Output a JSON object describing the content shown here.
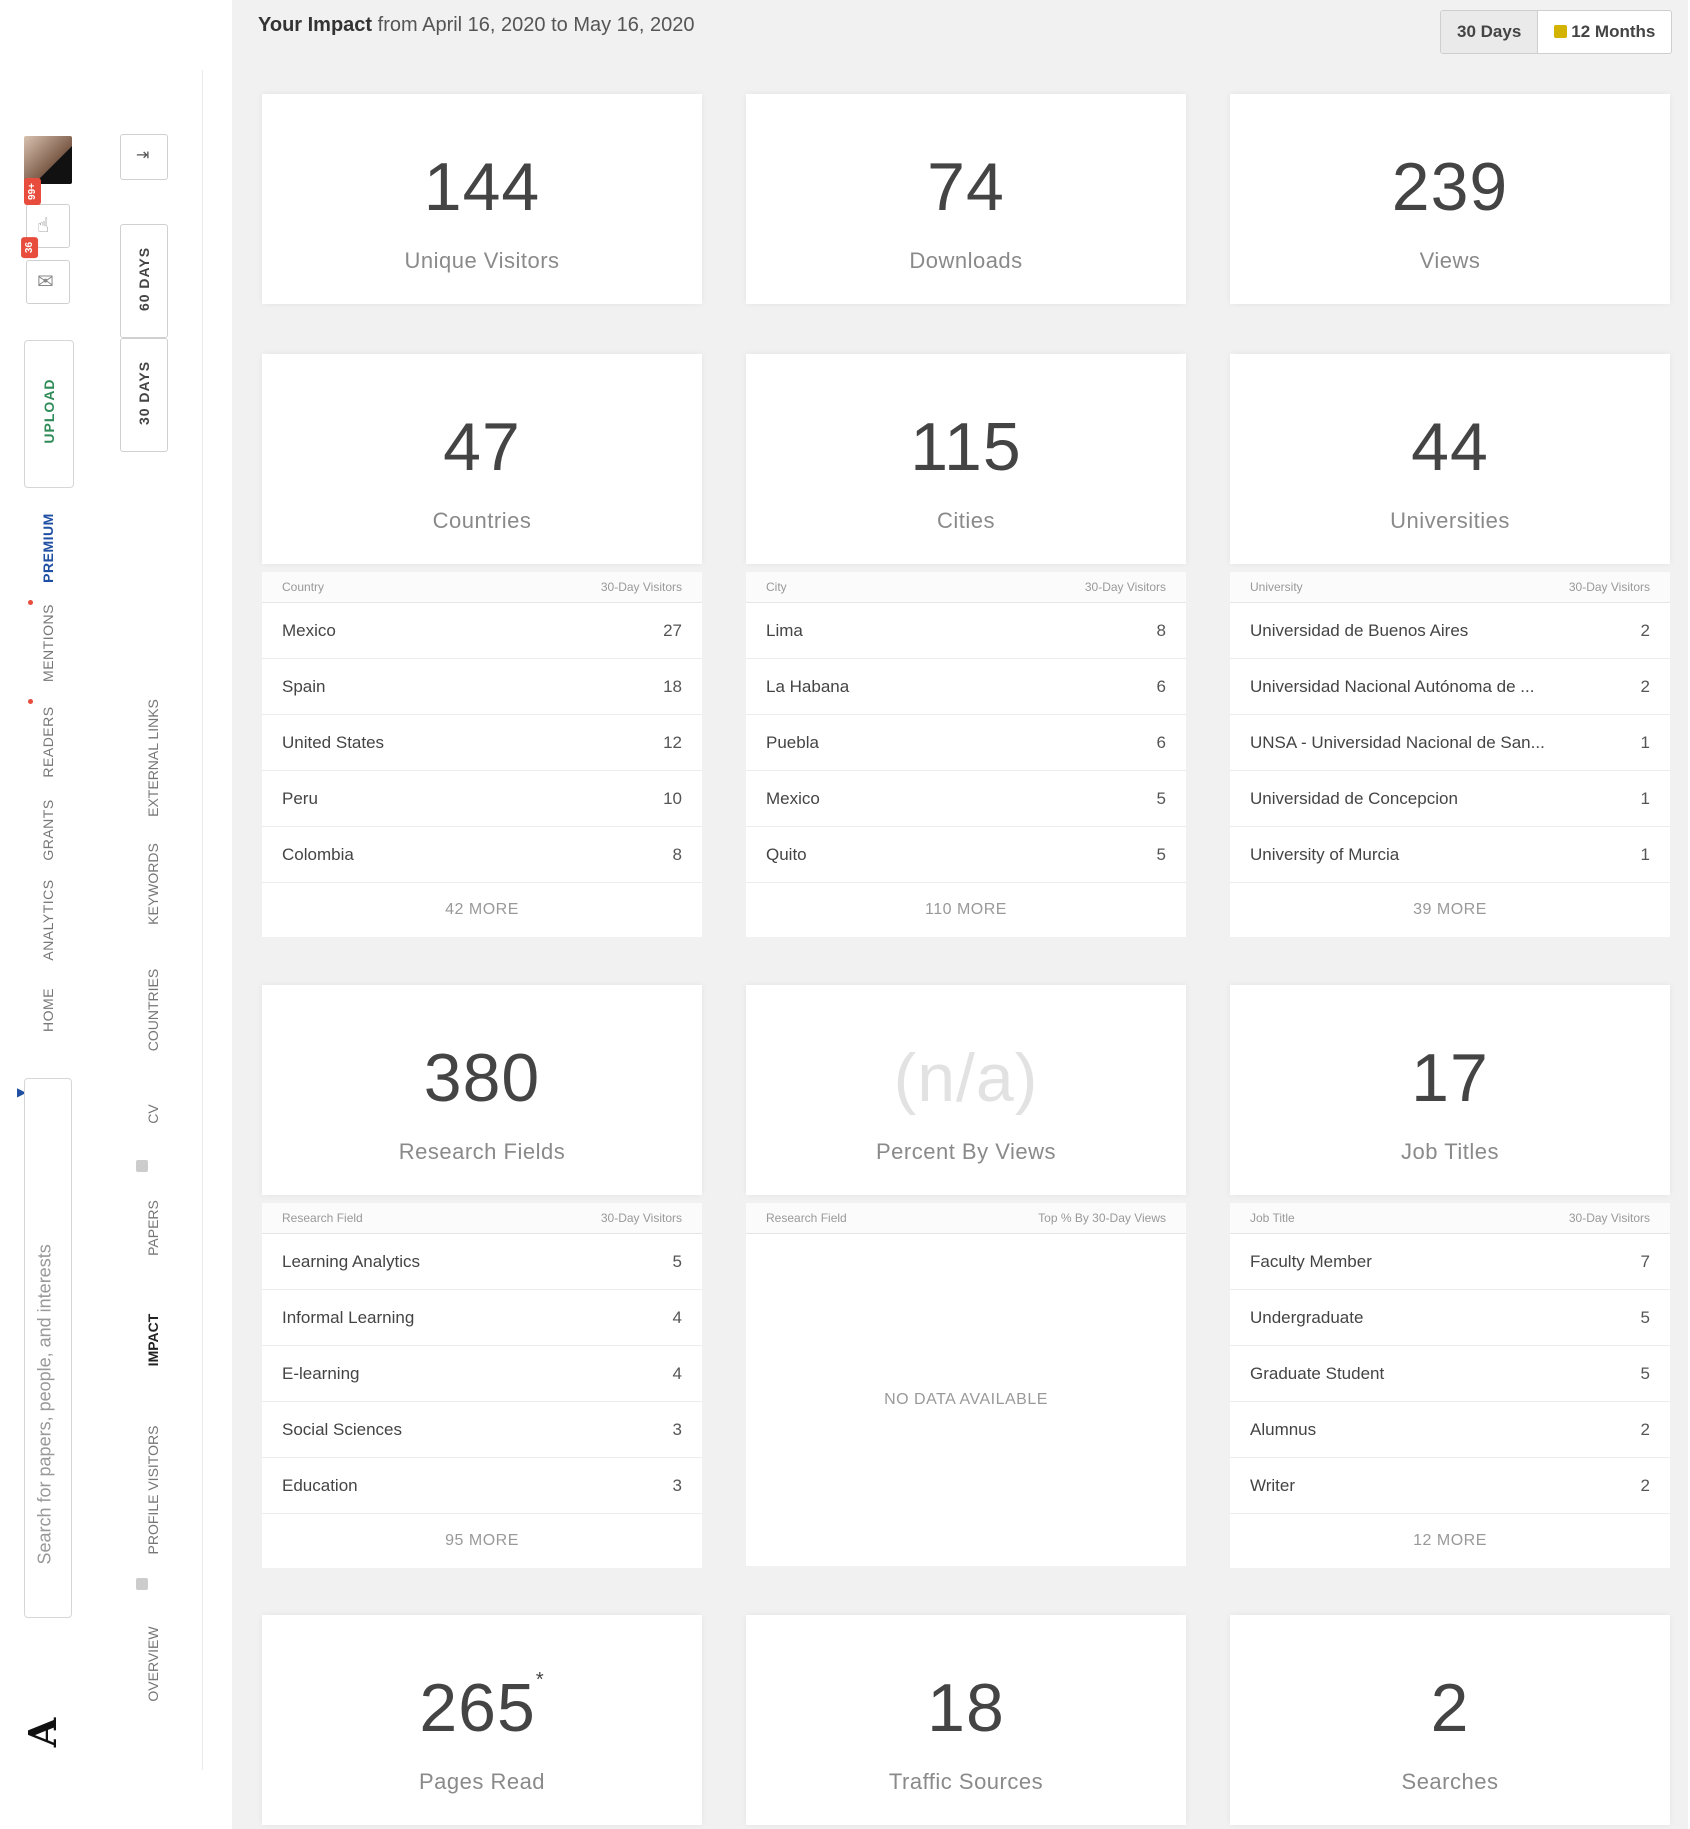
{
  "header": {
    "title_bold": "Your Impact",
    "title_rest": " from April 16, 2020 to May 16, 2020",
    "range_buttons": [
      "30 Days",
      "12 Months"
    ]
  },
  "rail": {
    "notif_badges": [
      "99+",
      "36"
    ],
    "upload_label": "UPLOAD",
    "links": [
      "PREMIUM",
      "MENTIONS",
      "READERS",
      "GRANTS",
      "ANALYTICS",
      "HOME"
    ],
    "search_placeholder": "Search for papers, people, and interests",
    "logo": "A"
  },
  "nav2": {
    "period_buttons": [
      "60 DAYS",
      "30 DAYS"
    ],
    "links": [
      "EXTERNAL LINKS",
      "KEYWORDS",
      "COUNTRIES",
      "CV",
      "PAPERS",
      "IMPACT",
      "PROFILE VISITORS",
      "OVERVIEW"
    ]
  },
  "stats_top": [
    {
      "value": "144",
      "label": "Unique Visitors"
    },
    {
      "value": "74",
      "label": "Downloads"
    },
    {
      "value": "239",
      "label": "Views"
    }
  ],
  "breakdowns_1": [
    {
      "value": "47",
      "label": "Countries",
      "col_left": "Country",
      "col_right": "30-Day Visitors",
      "rows": [
        [
          "Mexico",
          "27"
        ],
        [
          "Spain",
          "18"
        ],
        [
          "United States",
          "12"
        ],
        [
          "Peru",
          "10"
        ],
        [
          "Colombia",
          "8"
        ]
      ],
      "more": "42 MORE"
    },
    {
      "value": "115",
      "label": "Cities",
      "col_left": "City",
      "col_right": "30-Day Visitors",
      "rows": [
        [
          "Lima",
          "8"
        ],
        [
          "La Habana",
          "6"
        ],
        [
          "Puebla",
          "6"
        ],
        [
          "Mexico",
          "5"
        ],
        [
          "Quito",
          "5"
        ]
      ],
      "more": "110 MORE"
    },
    {
      "value": "44",
      "label": "Universities",
      "col_left": "University",
      "col_right": "30-Day Visitors",
      "rows": [
        [
          "Universidad de Buenos Aires",
          "2"
        ],
        [
          "Universidad Nacional Autónoma de ...",
          "2"
        ],
        [
          "UNSA - Universidad Nacional de San...",
          "1"
        ],
        [
          "Universidad de Concepcion",
          "1"
        ],
        [
          "University of Murcia",
          "1"
        ]
      ],
      "more": "39 MORE"
    }
  ],
  "breakdowns_2": [
    {
      "value": "380",
      "label": "Research Fields",
      "col_left": "Research Field",
      "col_right": "30-Day Visitors",
      "rows": [
        [
          "Learning Analytics",
          "5"
        ],
        [
          "Informal Learning",
          "4"
        ],
        [
          "E-learning",
          "4"
        ],
        [
          "Social Sciences",
          "3"
        ],
        [
          "Education",
          "3"
        ]
      ],
      "more": "95 MORE"
    },
    {
      "value": "(n/a)",
      "label": "Percent By Views",
      "col_left": "Research Field",
      "col_right": "Top % By 30-Day Views",
      "nodata": "NO DATA AVAILABLE"
    },
    {
      "value": "17",
      "label": "Job Titles",
      "col_left": "Job Title",
      "col_right": "30-Day Visitors",
      "rows": [
        [
          "Faculty Member",
          "7"
        ],
        [
          "Undergraduate",
          "5"
        ],
        [
          "Graduate Student",
          "5"
        ],
        [
          "Alumnus",
          "2"
        ],
        [
          "Writer",
          "2"
        ]
      ],
      "more": "12 MORE"
    }
  ],
  "stats_bottom": [
    {
      "value": "265",
      "label": "Pages Read",
      "mark": "*"
    },
    {
      "value": "18",
      "label": "Traffic Sources"
    },
    {
      "value": "2",
      "label": "Searches"
    }
  ]
}
